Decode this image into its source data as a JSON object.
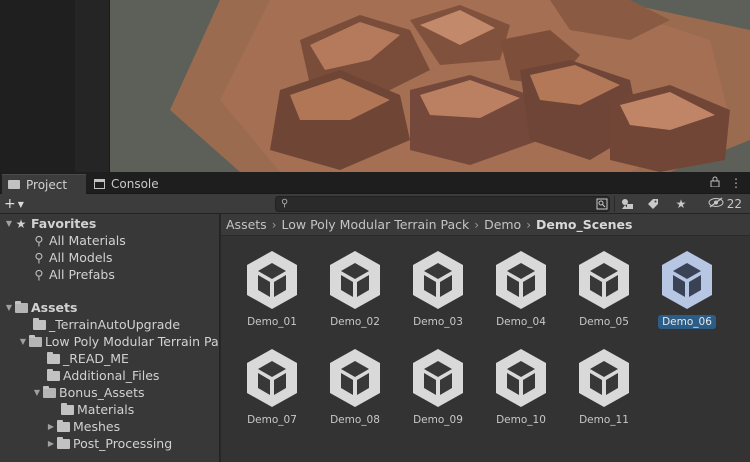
{
  "tabs": {
    "project": "Project",
    "console": "Console"
  },
  "tab_actions": {
    "lock_icon": "lock-icon",
    "menu_icon": "kebab-menu-icon"
  },
  "toolbar": {
    "add_label": "+",
    "search_placeholder": "",
    "hidden_count": "22"
  },
  "tree": {
    "favorites": {
      "label": "Favorites",
      "items": [
        "All Materials",
        "All Models",
        "All Prefabs"
      ]
    },
    "assets": {
      "label": "Assets",
      "items": [
        "_TerrainAutoUpgrade",
        "Low Poly Modular Terrain Pa",
        "_READ_ME",
        "Additional_Files",
        "Bonus_Assets",
        "Materials",
        "Meshes",
        "Post_Processing"
      ]
    }
  },
  "breadcrumb": {
    "items": [
      "Assets",
      "Low Poly Modular Terrain Pack",
      "Demo"
    ],
    "current": "Demo_Scenes"
  },
  "assets_grid": {
    "items": [
      "Demo_01",
      "Demo_02",
      "Demo_03",
      "Demo_04",
      "Demo_05",
      "Demo_06",
      "Demo_07",
      "Demo_08",
      "Demo_09",
      "Demo_10",
      "Demo_11"
    ],
    "selected": "Demo_06"
  },
  "colors": {
    "selection": "#2c5d87",
    "terrain": "#a0694a",
    "panel": "#383838"
  }
}
